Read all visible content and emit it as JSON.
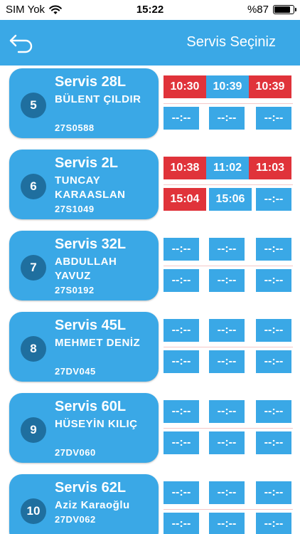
{
  "status_bar": {
    "carrier": "SIM Yok",
    "time": "15:22",
    "battery_text": "%87",
    "battery_level": 0.87
  },
  "header": {
    "title": "Servis Seçiniz"
  },
  "services": [
    {
      "number": "5",
      "title": "Servis 28L",
      "driver": "BÜLENT ÇILDIR",
      "plate": "27S0588",
      "times": [
        {
          "label": "10:30",
          "status": "red"
        },
        {
          "label": "10:39",
          "status": "blue"
        },
        {
          "label": "10:39",
          "status": "red"
        },
        {
          "label": "--:--",
          "status": "blue"
        },
        {
          "label": "--:--",
          "status": "blue"
        },
        {
          "label": "--:--",
          "status": "blue"
        }
      ]
    },
    {
      "number": "6",
      "title": "Servis 2L",
      "driver": "TUNCAY KARAASLAN",
      "plate": "27S1049",
      "times": [
        {
          "label": "10:38",
          "status": "red"
        },
        {
          "label": "11:02",
          "status": "blue"
        },
        {
          "label": "11:03",
          "status": "red"
        },
        {
          "label": "15:04",
          "status": "red"
        },
        {
          "label": "15:06",
          "status": "blue"
        },
        {
          "label": "--:--",
          "status": "blue"
        }
      ]
    },
    {
      "number": "7",
      "title": "Servis 32L",
      "driver": "ABDULLAH YAVUZ",
      "plate": "27S0192",
      "times": [
        {
          "label": "--:--",
          "status": "blue"
        },
        {
          "label": "--:--",
          "status": "blue"
        },
        {
          "label": "--:--",
          "status": "blue"
        },
        {
          "label": "--:--",
          "status": "blue"
        },
        {
          "label": "--:--",
          "status": "blue"
        },
        {
          "label": "--:--",
          "status": "blue"
        }
      ]
    },
    {
      "number": "8",
      "title": "Servis 45L",
      "driver": "MEHMET DENİZ",
      "plate": "27DV045",
      "times": [
        {
          "label": "--:--",
          "status": "blue"
        },
        {
          "label": "--:--",
          "status": "blue"
        },
        {
          "label": "--:--",
          "status": "blue"
        },
        {
          "label": "--:--",
          "status": "blue"
        },
        {
          "label": "--:--",
          "status": "blue"
        },
        {
          "label": "--:--",
          "status": "blue"
        }
      ]
    },
    {
      "number": "9",
      "title": "Servis 60L",
      "driver": "HÜSEYİN KILIÇ",
      "plate": "27DV060",
      "times": [
        {
          "label": "--:--",
          "status": "blue"
        },
        {
          "label": "--:--",
          "status": "blue"
        },
        {
          "label": "--:--",
          "status": "blue"
        },
        {
          "label": "--:--",
          "status": "blue"
        },
        {
          "label": "--:--",
          "status": "blue"
        },
        {
          "label": "--:--",
          "status": "blue"
        }
      ]
    },
    {
      "number": "10",
      "title": "Servis 62L",
      "driver": "Aziz Karaoğlu",
      "plate": "27DV062",
      "times": [
        {
          "label": "--:--",
          "status": "blue"
        },
        {
          "label": "--:--",
          "status": "blue"
        },
        {
          "label": "--:--",
          "status": "blue"
        },
        {
          "label": "--:--",
          "status": "blue"
        },
        {
          "label": "--:--",
          "status": "blue"
        },
        {
          "label": "--:--",
          "status": "blue"
        }
      ]
    }
  ],
  "colors": {
    "accent": "#3AA8E6",
    "badge": "#1F6F9F",
    "late": "#E0333A"
  },
  "icons": {
    "back": "back-arrow-icon",
    "wifi": "wifi-icon",
    "battery": "battery-icon"
  }
}
